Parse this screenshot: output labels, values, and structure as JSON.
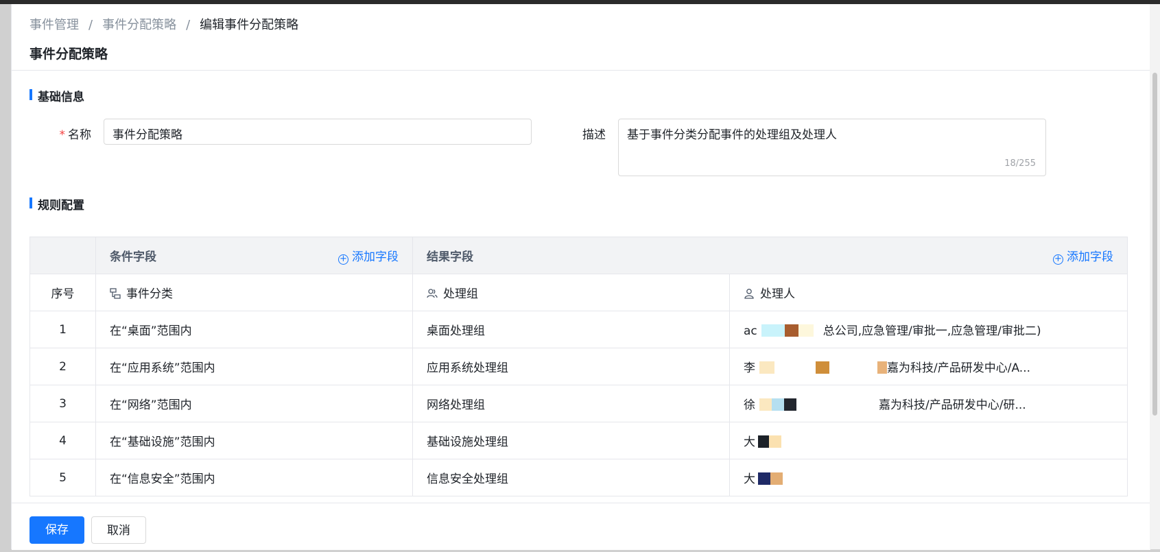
{
  "breadcrumb": {
    "items": [
      "事件管理",
      "事件分配策略",
      "编辑事件分配策略"
    ],
    "separator": "/"
  },
  "page_title": "事件分配策略",
  "basic_info": {
    "section_title": "基础信息",
    "name_label": "名称",
    "name_value": "事件分配策略",
    "desc_label": "描述",
    "desc_value": "基于事件分类分配事件的处理组及处理人",
    "desc_counter": "18/255"
  },
  "rules": {
    "section_title": "规则配置",
    "condition_header": "条件字段",
    "result_header": "结果字段",
    "add_field_label": "添加字段",
    "index_header": "序号",
    "columns": {
      "category": "事件分类",
      "group": "处理组",
      "assignee": "处理人"
    },
    "rows": [
      {
        "index": "1",
        "condition": "在“桌面”范围内",
        "group": "桌面处理组",
        "assignee_prefix": "ac",
        "assignee_suffix": "总公司,应急管理/审批一,应急管理/审批二)"
      },
      {
        "index": "2",
        "condition": "在“应用系统”范围内",
        "group": "应用系统处理组",
        "assignee_prefix": "李",
        "assignee_suffix": "嘉为科技/产品研发中心/A..."
      },
      {
        "index": "3",
        "condition": "在“网络”范围内",
        "group": "网络处理组",
        "assignee_prefix": "徐",
        "assignee_suffix": "嘉为科技/产品研发中心/研..."
      },
      {
        "index": "4",
        "condition": "在“基础设施”范围内",
        "group": "基础设施处理组",
        "assignee_prefix": "大",
        "assignee_suffix": ""
      },
      {
        "index": "5",
        "condition": "在“信息安全”范围内",
        "group": "信息安全处理组",
        "assignee_prefix": "大",
        "assignee_suffix": ""
      }
    ]
  },
  "footer": {
    "save_label": "保存",
    "cancel_label": "取消"
  },
  "icons": {
    "category": "tree-icon",
    "group": "users-icon",
    "assignee": "user-icon",
    "add": "plus-circle-icon"
  },
  "colors": {
    "primary": "#1677ff",
    "required": "#f53f3f"
  }
}
